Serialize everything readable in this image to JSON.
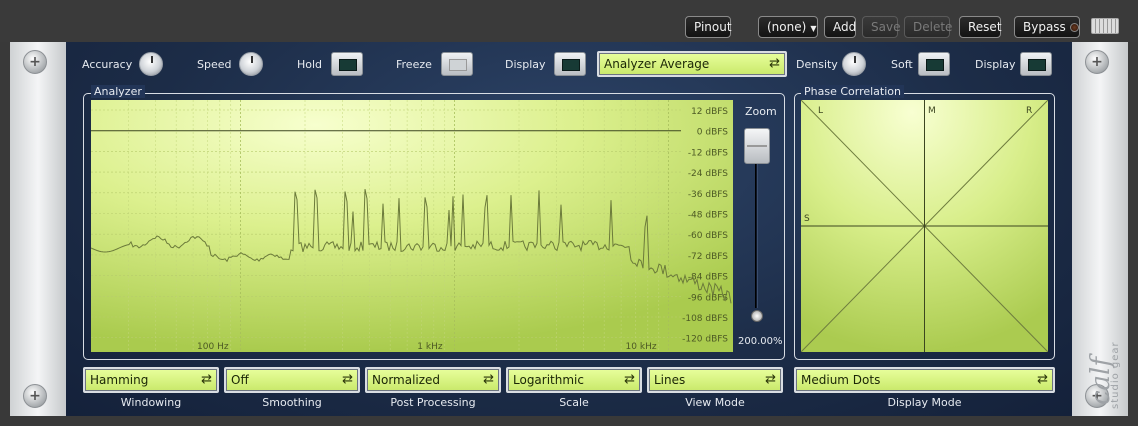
{
  "toolbar": {
    "pinout": "Pinout",
    "preset": "(none)",
    "add": "Add",
    "save": "Save",
    "delete": "Delete",
    "reset": "Reset",
    "bypass": "Bypass"
  },
  "brand": {
    "logo": "calf",
    "tagline": "studio gear"
  },
  "controls": {
    "accuracy": "Accuracy",
    "speed": "Speed",
    "hold": "Hold",
    "freeze": "Freeze",
    "display": "Display",
    "mode_select": "Analyzer Average",
    "density": "Density",
    "soft": "Soft",
    "display2": "Display"
  },
  "analyzer": {
    "title": "Analyzer",
    "db_labels": [
      "12 dBFS",
      "0 dBFS",
      "-12 dBFS",
      "-24 dBFS",
      "-36 dBFS",
      "-48 dBFS",
      "-60 dBFS",
      "-72 dBFS",
      "-84 dBFS",
      "-96 dBFS",
      "-108 dBFS",
      "-120 dBFS"
    ],
    "freq_labels": [
      "100 Hz",
      "1 kHz",
      "10 kHz"
    ],
    "zoom_label": "Zoom",
    "zoom_value": "200.00%"
  },
  "phase": {
    "title": "Phase Correlation",
    "labels": {
      "l": "L",
      "m": "M",
      "r": "R",
      "s": "S"
    }
  },
  "selectors": [
    {
      "value": "Hamming",
      "label": "Windowing"
    },
    {
      "value": "Off",
      "label": "Smoothing"
    },
    {
      "value": "Normalized",
      "label": "Post Processing"
    },
    {
      "value": "Logarithmic",
      "label": "Scale"
    },
    {
      "value": "Lines",
      "label": "View Mode"
    },
    {
      "value": "Medium Dots",
      "label": "Display Mode"
    }
  ],
  "colors": {
    "lcd_light": "#f2ffb8",
    "lcd_dark": "#b9d85a",
    "panel": "#1c2c47",
    "trace": "#6b7a3a"
  }
}
